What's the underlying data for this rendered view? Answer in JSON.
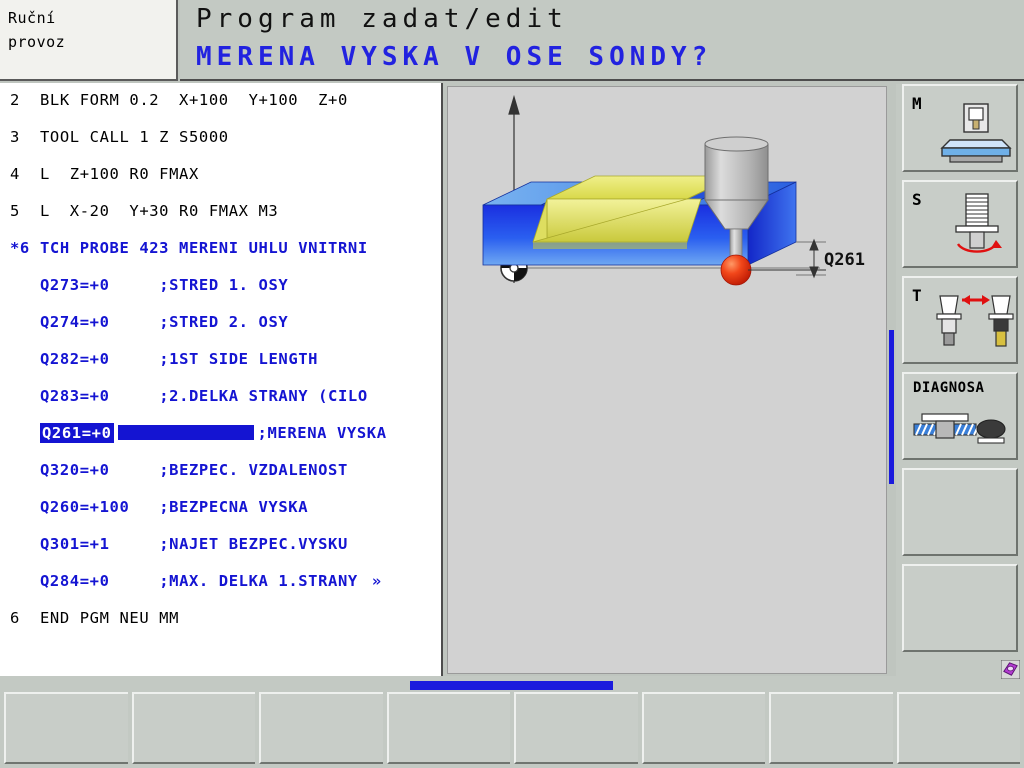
{
  "header": {
    "mode_line1": "Ruční",
    "mode_line2": "provoz",
    "title": "Program zadat/edit",
    "prompt": "MERENA VYSKA V OSE SONDY?"
  },
  "colors": {
    "blue_text": "#1414d2",
    "highlight": "#1414d2",
    "panel_bg": "#c3c9c3",
    "program_bg": "#ffffff",
    "graphic_bg": "#d2d2d2",
    "workpiece_blue": "#1a35e0",
    "pocket_yellow": "#e2e24a",
    "ruby_red": "#ee3311",
    "probe_gray": "#b0b0b0"
  },
  "program": {
    "lines": [
      {
        "num": "2",
        "text": "BLK FORM 0.2  X+100  Y+100  Z+0",
        "color": "black",
        "indent": 0
      },
      {
        "num": "3",
        "text": "TOOL CALL 1 Z S5000",
        "color": "black",
        "indent": 0
      },
      {
        "num": "4",
        "text": "L  Z+100 R0 FMAX",
        "color": "black",
        "indent": 0
      },
      {
        "num": "5",
        "text": "L  X-20  Y+30 R0 FMAX M3",
        "color": "black",
        "indent": 0
      },
      {
        "num": "*6",
        "text": "TCH PROBE 423 MERENI UHLU VNITRNI",
        "color": "blue",
        "indent": 0
      },
      {
        "num": "",
        "param": "Q273=+0",
        "comment": ";STRED 1. OSY",
        "color": "blue",
        "indent": 1
      },
      {
        "num": "",
        "param": "Q274=+0",
        "comment": ";STRED 2. OSY",
        "color": "blue",
        "indent": 1
      },
      {
        "num": "",
        "param": "Q282=+0",
        "comment": ";1ST SIDE LENGTH",
        "color": "blue",
        "indent": 1
      },
      {
        "num": "",
        "param": "Q283=+0",
        "comment": ";2.DELKA STRANY (CILO",
        "color": "blue",
        "indent": 1
      },
      {
        "num": "",
        "param": "Q261=+0",
        "comment": ";MERENA VYSKA",
        "color": "blue",
        "indent": 1,
        "selected": true
      },
      {
        "num": "",
        "param": "Q320=+0",
        "comment": ";BEZPEC. VZDALENOST",
        "color": "blue",
        "indent": 1
      },
      {
        "num": "",
        "param": "Q260=+100",
        "comment": ";BEZPECNA VYSKA",
        "color": "blue",
        "indent": 1
      },
      {
        "num": "",
        "param": "Q301=+1",
        "comment": ";NAJET BEZPEC.VYSKU",
        "color": "blue",
        "indent": 1
      },
      {
        "num": "",
        "param": "Q284=+0",
        "comment": ";MAX. DELKA 1.STRANY",
        "color": "blue",
        "indent": 1,
        "more": "»"
      },
      {
        "num": "6",
        "text": "END PGM NEU MM",
        "color": "black",
        "indent": 0
      }
    ]
  },
  "graphic": {
    "dimension_label": "Q261",
    "origin_icon": "datum-origin-icon",
    "axis_icon": "vertical-axis-arrow",
    "probe_icon": "touch-probe-icon",
    "workpiece_icon": "workpiece-block-icon"
  },
  "right_softkeys": [
    {
      "label": "M",
      "icon": "machine-table-icon",
      "wide": false
    },
    {
      "label": "S",
      "icon": "spindle-speed-icon",
      "wide": false
    },
    {
      "label": "T",
      "icon": "tool-change-icon",
      "wide": false
    },
    {
      "label": "DIAGNOSA",
      "icon": "diagnosis-icon",
      "wide": true
    },
    {
      "label": "",
      "icon": "",
      "wide": false
    },
    {
      "label": "",
      "icon": "",
      "wide": false
    }
  ],
  "bottom_softkeys": [
    {
      "label": ""
    },
    {
      "label": ""
    },
    {
      "label": ""
    },
    {
      "label": ""
    },
    {
      "label": ""
    },
    {
      "label": ""
    },
    {
      "label": ""
    },
    {
      "label": ""
    }
  ],
  "corner": {
    "icon": "help-book-icon"
  }
}
